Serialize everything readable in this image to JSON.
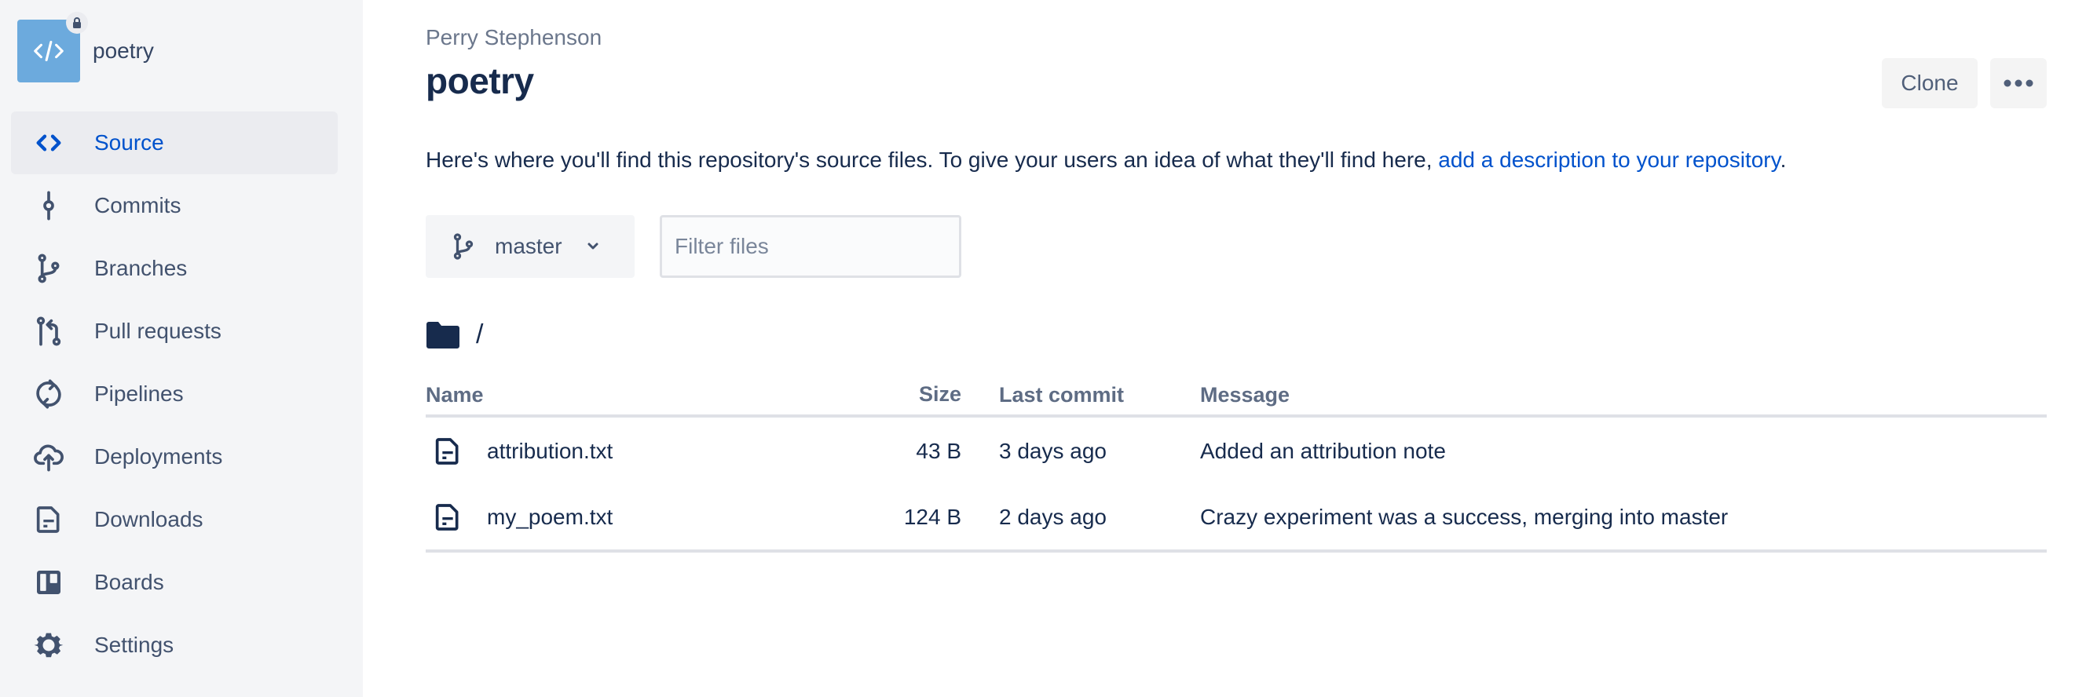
{
  "sidebar": {
    "repo_name": "poetry",
    "repo_avatar_icon": "code-icon",
    "repo_private_icon": "lock-icon",
    "items": [
      {
        "label": "Source",
        "icon": "source-code-icon",
        "active": true
      },
      {
        "label": "Commits",
        "icon": "commit-icon",
        "active": false
      },
      {
        "label": "Branches",
        "icon": "branch-icon",
        "active": false
      },
      {
        "label": "Pull requests",
        "icon": "pull-request-icon",
        "active": false
      },
      {
        "label": "Pipelines",
        "icon": "refresh-cycle-icon",
        "active": false
      },
      {
        "label": "Deployments",
        "icon": "cloud-upload-icon",
        "active": false
      },
      {
        "label": "Downloads",
        "icon": "document-icon",
        "active": false
      },
      {
        "label": "Boards",
        "icon": "board-icon",
        "active": false
      },
      {
        "label": "Settings",
        "icon": "gear-icon",
        "active": false
      }
    ]
  },
  "header": {
    "owner": "Perry Stephenson",
    "title": "poetry",
    "clone_label": "Clone",
    "more_icon": "more-horizontal-icon"
  },
  "description": {
    "text": "Here's where you'll find this repository's source files. To give your users an idea of what they'll find here, ",
    "link_text": "add a description to your repository",
    "suffix": "."
  },
  "toolbar": {
    "branch": "master",
    "filter_placeholder": "Filter files",
    "filter_value": ""
  },
  "path": {
    "current": "/"
  },
  "files": {
    "columns": [
      "Name",
      "Size",
      "Last commit",
      "Message"
    ],
    "rows": [
      {
        "name": "attribution.txt",
        "size": "43 B",
        "last_commit": "3 days ago",
        "message": "Added an attribution note"
      },
      {
        "name": "my_poem.txt",
        "size": "124 B",
        "last_commit": "2 days ago",
        "message": "Crazy experiment was a success, merging into master"
      }
    ]
  },
  "colors": {
    "accent": "#0052CC",
    "sidebar_bg": "#F4F5F7",
    "active_item_bg": "#EBECF0",
    "repo_avatar": "#6CAADD",
    "text_primary": "#172B4D",
    "text_secondary": "#42526E"
  }
}
